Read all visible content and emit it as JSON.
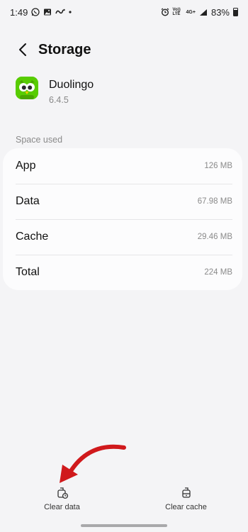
{
  "status_bar": {
    "time": "1:49",
    "battery": "83%",
    "signal_text_1": "Vo)) LTE",
    "signal_text_2": "4G+"
  },
  "header": {
    "title": "Storage"
  },
  "app": {
    "name": "Duolingo",
    "version": "6.4.5",
    "icon_color": "#58cc02"
  },
  "section": {
    "label": "Space used"
  },
  "storage_rows": [
    {
      "label": "App",
      "value": "126 MB"
    },
    {
      "label": "Data",
      "value": "67.98 MB"
    },
    {
      "label": "Cache",
      "value": "29.46 MB"
    },
    {
      "label": "Total",
      "value": "224 MB"
    }
  ],
  "bottom_actions": {
    "clear_data": "Clear data",
    "clear_cache": "Clear cache"
  },
  "annotation": {
    "arrow_color": "#d0191c"
  }
}
